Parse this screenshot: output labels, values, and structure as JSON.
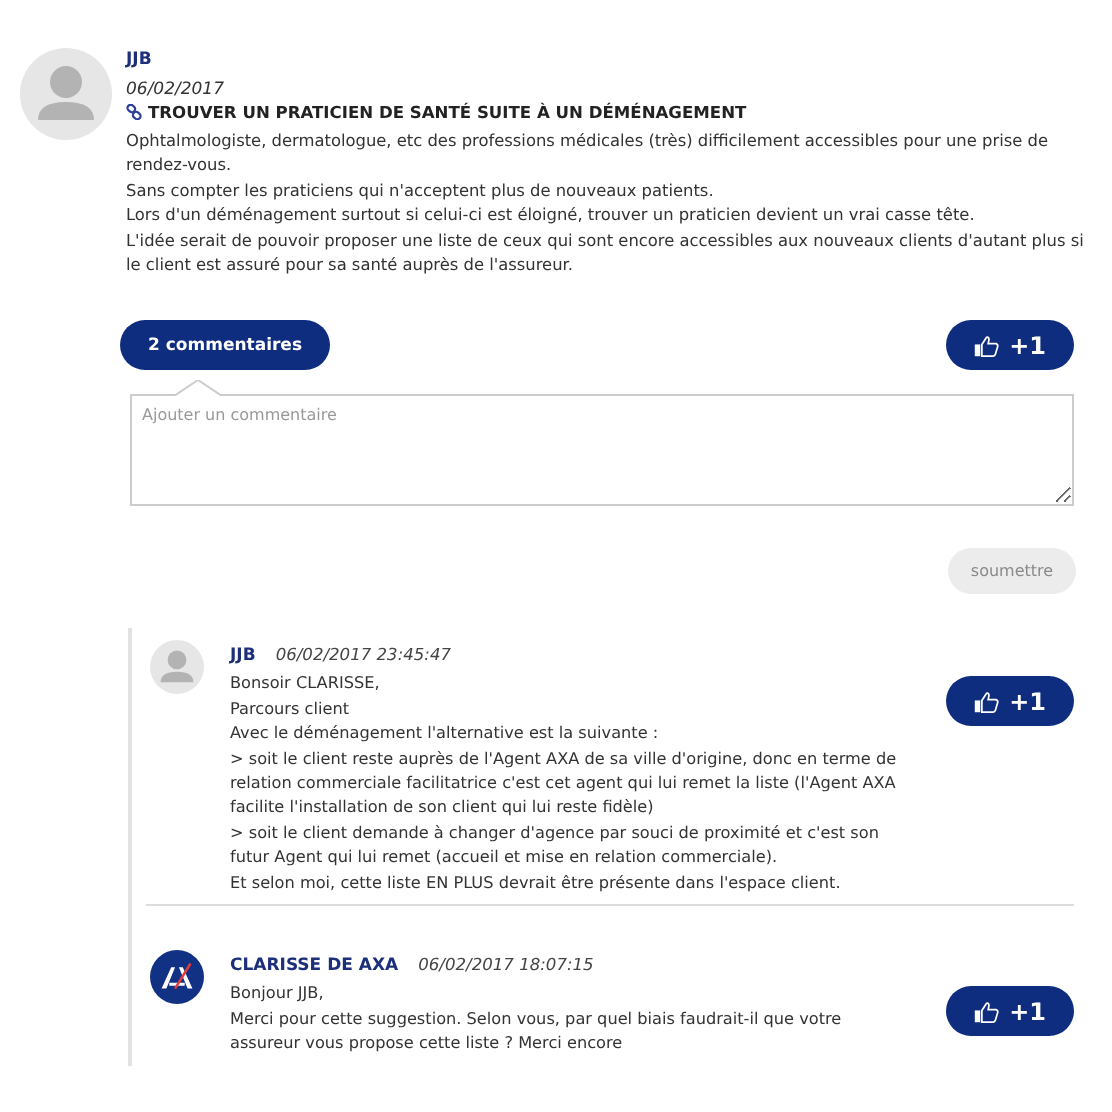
{
  "post": {
    "author": "JJB",
    "date": "06/02/2017",
    "title": "TROUVER UN PRATICIEN DE SANTÉ SUITE À UN DÉMÉNAGEMENT",
    "body": [
      "Ophtalmologiste, dermatologue, etc des professions médicales (très) difficilement accessibles pour une prise de",
      "rendez-vous.",
      "Sans compter les praticiens qui n'acceptent plus de nouveaux patients.",
      "Lors d'un déménagement surtout si celui-ci est éloigné, trouver un praticien devient un vrai casse tête.",
      "L'idée serait de pouvoir proposer une liste de ceux qui sont encore accessibles aux nouveaux clients d'autant plus si",
      "le client est assuré pour sa santé auprès de l'assureur."
    ],
    "comments_button": "2 commentaires",
    "like_label": "+1"
  },
  "comment_form": {
    "placeholder": "Ajouter un commentaire",
    "submit": "soumettre",
    "submit_disabled": true
  },
  "comments": [
    {
      "kind": "person",
      "author": "JJB",
      "datetime": "06/02/2017 23:45:47",
      "like_label": "+1",
      "body": [
        "Bonsoir CLARISSE,",
        "Parcours client",
        "Avec le déménagement l'alternative est la suivante :",
        "> soit le client reste auprès de l'Agent AXA de sa ville d'origine, donc en terme de",
        "relation commerciale facilitatrice c'est cet agent qui lui remet la liste (l'Agent AXA",
        "facilite l'installation de son client qui lui reste fidèle)",
        "> soit le client demande à changer d'agence par souci de proximité et c'est son",
        "futur Agent qui lui remet (accueil et mise en relation commerciale).",
        "Et selon moi, cette liste EN PLUS devrait être présente dans l'espace client."
      ]
    },
    {
      "kind": "logo",
      "author": "CLARISSE DE AXA",
      "datetime": "06/02/2017 18:07:15",
      "like_label": "+1",
      "body": [
        "Bonjour JJB,",
        "Merci pour cette suggestion. Selon vous, par quel biais faudrait-il que votre",
        "assureur vous propose cette liste ? Merci encore"
      ]
    }
  ]
}
